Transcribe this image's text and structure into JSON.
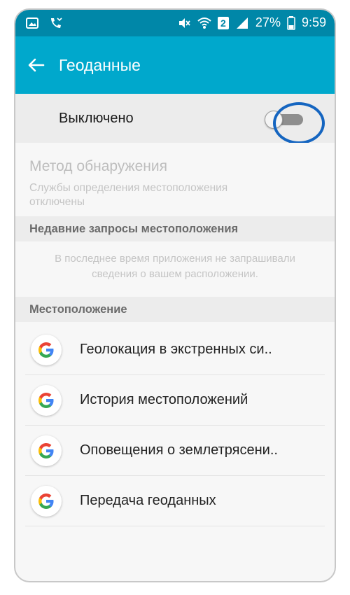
{
  "status_bar": {
    "battery_percent": "27%",
    "time": "9:59",
    "sim_number": "2",
    "icons": [
      "gallery-icon",
      "missed-call-icon",
      "mute-icon",
      "wifi-icon",
      "sim-icon",
      "signal-icon",
      "battery-icon"
    ]
  },
  "app_bar": {
    "title": "Геоданные",
    "back_icon": "arrow-left-icon"
  },
  "toggle": {
    "label": "Выключено",
    "state": "off"
  },
  "detection": {
    "title": "Метод обнаружения",
    "subtitle": "Службы определения местоположения отключены"
  },
  "recent": {
    "header": "Недавние запросы местоположения",
    "message_line1": "В последнее время приложения не запрашивали",
    "message_line2": "сведения о вашем расположении."
  },
  "location": {
    "header": "Местоположение",
    "items": [
      {
        "label": "Геолокация в экстренных си..",
        "icon": "google-icon"
      },
      {
        "label": "История местоположений",
        "icon": "google-icon"
      },
      {
        "label": "Оповещения о землетрясени..",
        "icon": "google-icon"
      },
      {
        "label": "Передача геоданных",
        "icon": "google-icon"
      }
    ]
  },
  "colors": {
    "status_bar": "#0087a8",
    "app_bar": "#00a8cc",
    "highlight": "#1565c0"
  }
}
